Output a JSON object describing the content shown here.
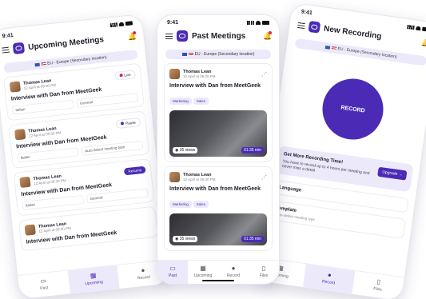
{
  "status": {
    "time": "9:41"
  },
  "left_phone": {
    "title": "Upcoming Meetings",
    "region": "EU - Europe (Secondary location)",
    "meetings": [
      {
        "name": "Thomas Lean",
        "date": "12 April at 09:30 PM",
        "title": "Interview with Dan from MeetGeek",
        "badge": "Live",
        "lang": "Italian",
        "type": "General"
      },
      {
        "name": "Thomas Lean",
        "date": "12 April at 09:30 PM",
        "title": "Interview with Dan from MeetGeek",
        "badge": "Pause",
        "lang": "Italian",
        "type": "Auto-detect meeting type"
      },
      {
        "name": "Thomas Lean",
        "date": "12 April at 09:30 PM",
        "title": "Interview with Dan from MeetGeek",
        "badge": "Resume",
        "lang": "Italian",
        "type": "General"
      },
      {
        "name": "Thomas Lean",
        "date": "12 April at 09:30 PM",
        "title": "Interview with Dan from MeetGeek",
        "badge": "",
        "lang": "Italian",
        "type": "General"
      }
    ],
    "nav": [
      "Past",
      "Upcoming",
      "Record"
    ]
  },
  "center_phone": {
    "title": "Past Meetings",
    "region": "EU - Europe (Secondary location)",
    "meetings": [
      {
        "name": "Thomas Lean",
        "date": "12 April at 09:30 PM",
        "title": "Interview with Dan from MeetGeek",
        "tags": [
          "Marketing",
          "Sales"
        ],
        "views": "35 views",
        "duration": "01:35 min"
      },
      {
        "name": "Thomas Lean",
        "date": "12 April at 09:30 PM",
        "title": "Interview with Dan from MeetGeek",
        "tags": [
          "Marketing",
          "Sales"
        ],
        "views": "35 views",
        "duration": "01:35 min"
      }
    ],
    "nav": [
      "Past",
      "Upcoming",
      "Record",
      "Files"
    ]
  },
  "right_phone": {
    "title": "New Recording",
    "region": "EU - Europe (Secondary location)",
    "record_label": "RECORD",
    "promo_title": "Get More Recording Time!",
    "promo_text": "You have to record up to 4 hours per meeting and never miss a detail",
    "upgrade": "Upgrade →",
    "language_label": "Language",
    "template_label": "Template",
    "template_value": "Auto-detect meeting type",
    "nav": [
      "Upcoming",
      "Record",
      "Files"
    ]
  },
  "colors": {
    "accent": "#4b2bb5",
    "accent_light": "#ece9fb",
    "live": "#e0245e"
  }
}
